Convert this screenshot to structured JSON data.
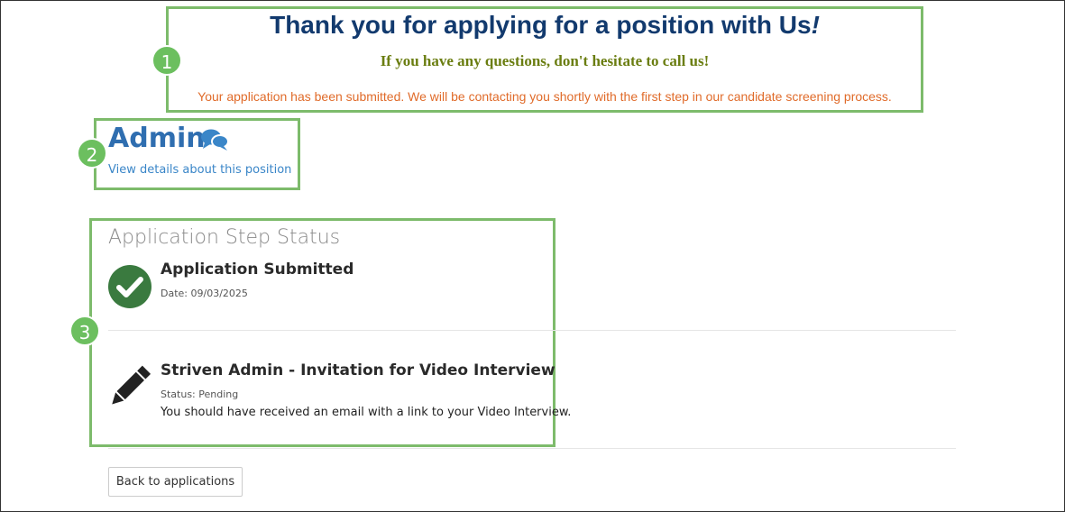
{
  "confirmation": {
    "title": "Thank you for applying for a position with Us",
    "title_punct": "!",
    "questions_line": "If you have any questions, don't hesitate to call us!",
    "submitted_message": "Your application has been submitted.  We will be contacting you shortly with the first step in our candidate screening process."
  },
  "position": {
    "title": "Admin",
    "details_link": "View details about this position",
    "icon": "comments-icon"
  },
  "status": {
    "heading": "Application Step Status",
    "steps": [
      {
        "title": "Application Submitted",
        "meta": "Date: 09/03/2025",
        "icon": "check-circle-icon"
      },
      {
        "title": "Striven Admin - Invitation for Video Interview",
        "meta": "Status: Pending",
        "description": "You should have received an email with a link to your Video Interview.",
        "icon": "pencil-icon"
      }
    ]
  },
  "actions": {
    "back_label": "Back to applications"
  },
  "callouts": [
    "1",
    "2",
    "3"
  ],
  "colors": {
    "callout_green": "#7dbb6b",
    "badge_green": "#6cbf5f",
    "title_navy": "#123a6e",
    "questions_olive": "#6a7d10",
    "message_orange": "#e06b2a",
    "admin_blue": "#2f6eb0",
    "check_green": "#3a7a3f"
  }
}
